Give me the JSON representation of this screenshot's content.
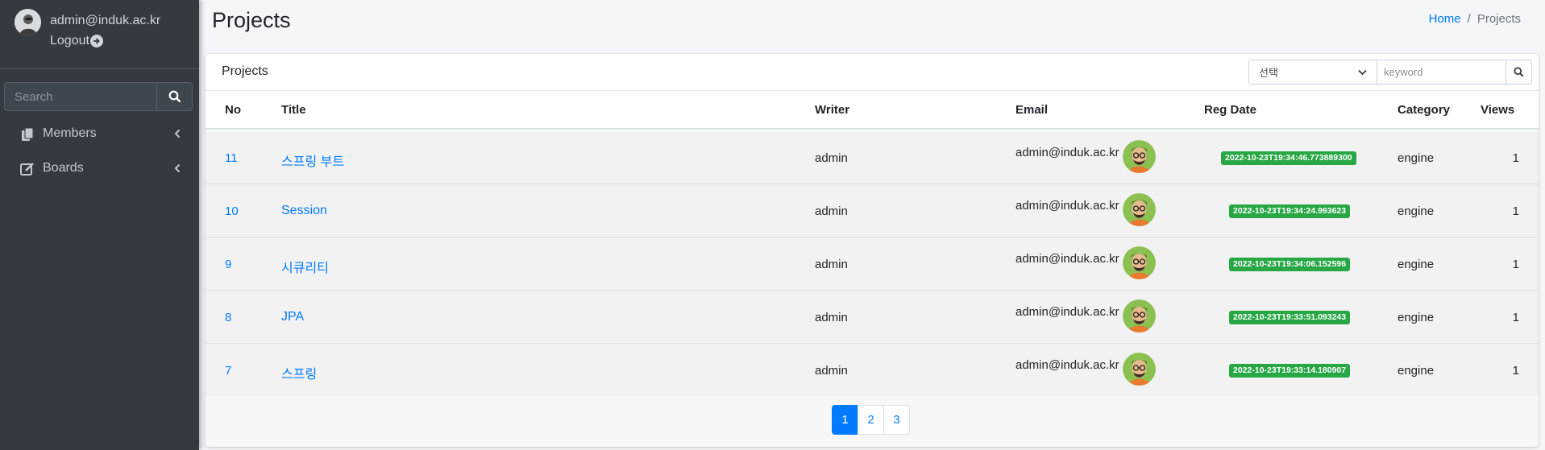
{
  "sidebar": {
    "user_email": "admin@induk.ac.kr",
    "logout_label": "Logout",
    "search_placeholder": "Search",
    "items": [
      {
        "label": "Members",
        "icon": "copy-icon"
      },
      {
        "label": "Boards",
        "icon": "edit-icon"
      }
    ]
  },
  "header": {
    "title": "Projects",
    "breadcrumb": {
      "home": "Home",
      "separator": "/",
      "current": "Projects"
    }
  },
  "card": {
    "title": "Projects",
    "select_value": "선택",
    "keyword_placeholder": "keyword"
  },
  "table": {
    "columns": [
      "No",
      "Title",
      "Writer",
      "Email",
      "Reg Date",
      "Category",
      "Views"
    ],
    "rows": [
      {
        "no": "11",
        "title": "스프링 부트",
        "writer": "admin",
        "email": "admin@induk.ac.kr",
        "reg_date": "2022-10-23T19:34:46.773889300",
        "category": "engine",
        "views": "1"
      },
      {
        "no": "10",
        "title": "Session",
        "writer": "admin",
        "email": "admin@induk.ac.kr",
        "reg_date": "2022-10-23T19:34:24.993623",
        "category": "engine",
        "views": "1"
      },
      {
        "no": "9",
        "title": "시큐리티",
        "writer": "admin",
        "email": "admin@induk.ac.kr",
        "reg_date": "2022-10-23T19:34:06.152596",
        "category": "engine",
        "views": "1"
      },
      {
        "no": "8",
        "title": "JPA",
        "writer": "admin",
        "email": "admin@induk.ac.kr",
        "reg_date": "2022-10-23T19:33:51.093243",
        "category": "engine",
        "views": "1"
      },
      {
        "no": "7",
        "title": "스프링",
        "writer": "admin",
        "email": "admin@induk.ac.kr",
        "reg_date": "2022-10-23T19:33:14.180907",
        "category": "engine",
        "views": "1"
      }
    ]
  },
  "pagination": {
    "pages": [
      "1",
      "2",
      "3"
    ],
    "active": "1"
  },
  "colors": {
    "primary": "#007bff",
    "badge_success": "#28a745",
    "sidebar_bg": "#343a40"
  }
}
